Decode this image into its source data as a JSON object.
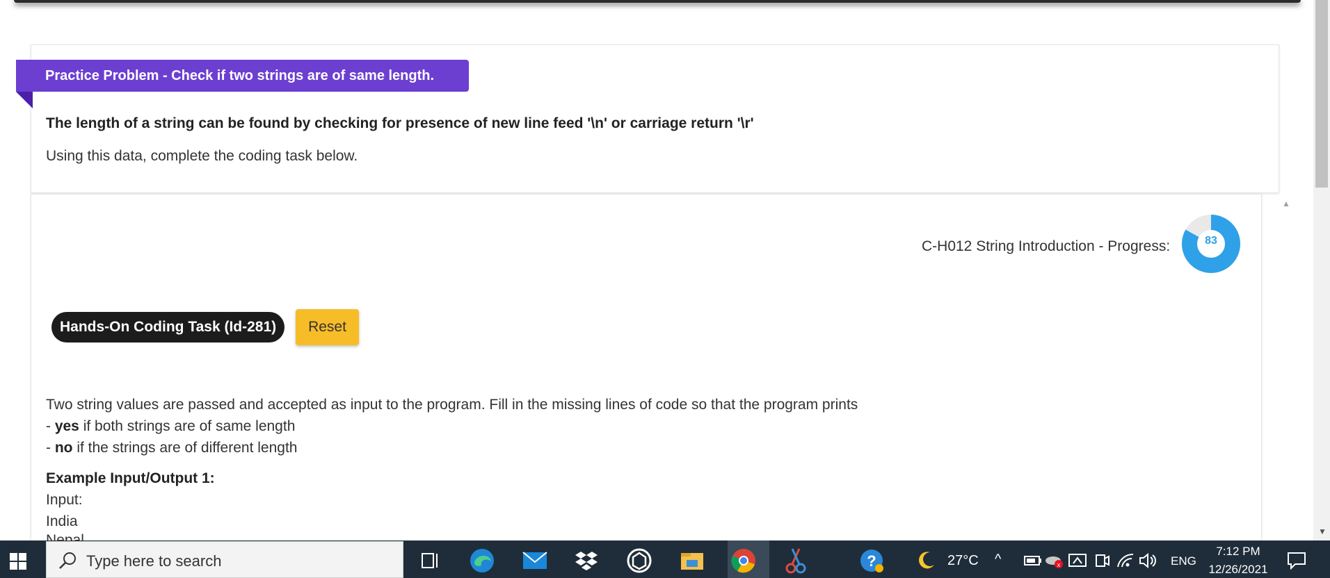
{
  "problem": {
    "banner": "Practice Problem - Check if two strings are of same length.",
    "hint": "The length of a string can be found by checking for presence of new line feed '\\n' or carriage return '\\r'",
    "hint_sub": "Using this data, complete the coding task below."
  },
  "progress": {
    "label": "C-H012 String Introduction - Progress:",
    "value": "83",
    "fraction": 0.83,
    "color": "#2ea1e8"
  },
  "task": {
    "title": "Hands-On Coding Task (Id-281)",
    "reset_label": "Reset",
    "description_line1": "Two string values are passed and accepted as input to the program. Fill in the missing lines of code so that the program prints",
    "bullet_yes_prefix": "- ",
    "bullet_yes_bold": "yes",
    "bullet_yes_rest": " if both strings are of same length",
    "bullet_no_prefix": "- ",
    "bullet_no_bold": "no",
    "bullet_no_rest": " if the strings are of different length",
    "example_title": "Example Input/Output 1:",
    "input_label": "Input:",
    "input_line1": "India",
    "input_line2": "Nepal"
  },
  "taskbar": {
    "search_placeholder": "Type here to search",
    "temperature": "27°C",
    "language": "ENG",
    "time": "7:12 PM",
    "date": "12/26/2021",
    "icons": [
      "windows-start-icon",
      "search-icon",
      "task-view-icon",
      "edge-icon",
      "mail-icon",
      "dropbox-icon",
      "app-icon",
      "file-explorer-icon",
      "chrome-icon",
      "snipping-tool-icon",
      "help-icon",
      "weather-moon-icon",
      "chevron-up-icon",
      "battery-icon",
      "onedrive-icon",
      "network-icon",
      "meet-icon",
      "wifi-icon",
      "volume-icon",
      "notification-icon"
    ]
  },
  "colors": {
    "banner": "#6c3fd1",
    "reset": "#f7bd28",
    "taskbar": "#1f2d3a"
  }
}
